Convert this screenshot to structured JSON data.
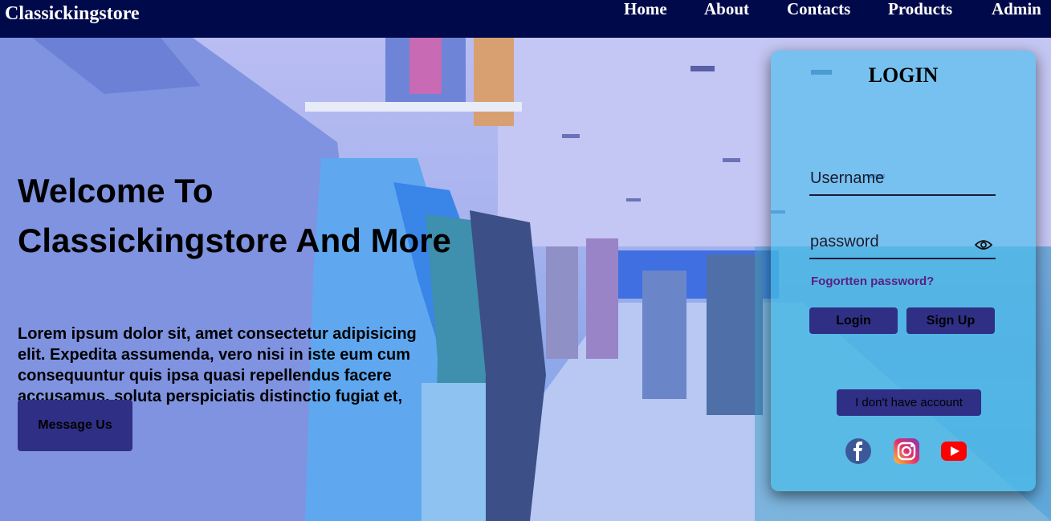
{
  "navbar": {
    "brand": "Classickingstore",
    "links": [
      "Home",
      "About",
      "Contacts",
      "Products",
      "Admin"
    ]
  },
  "hero": {
    "title": "Welcome To Classickingstore And More",
    "description": "Lorem ipsum dolor sit, amet consectetur adipisicing elit. Expedita assumenda, vero nisi in iste eum cum consequuntur quis ipsa quasi repellendus facere accusamus, soluta perspiciatis distinctio fugiat et, aliquid illo?",
    "cta_label": "Message Us"
  },
  "login": {
    "title": "LOGIN",
    "username_placeholder": "Username",
    "password_placeholder": "password",
    "forgot_label": "Fogortten password?",
    "login_label": "Login",
    "signup_label": "Sign Up",
    "no_account_label": "I don't have account",
    "social": [
      "facebook-icon",
      "instagram-icon",
      "youtube-icon"
    ]
  },
  "colors": {
    "navbar_bg": "#000a4a",
    "button_bg": "#2f2f86",
    "card_bg": "#46bee9",
    "forgot_link": "#5b1e82"
  }
}
